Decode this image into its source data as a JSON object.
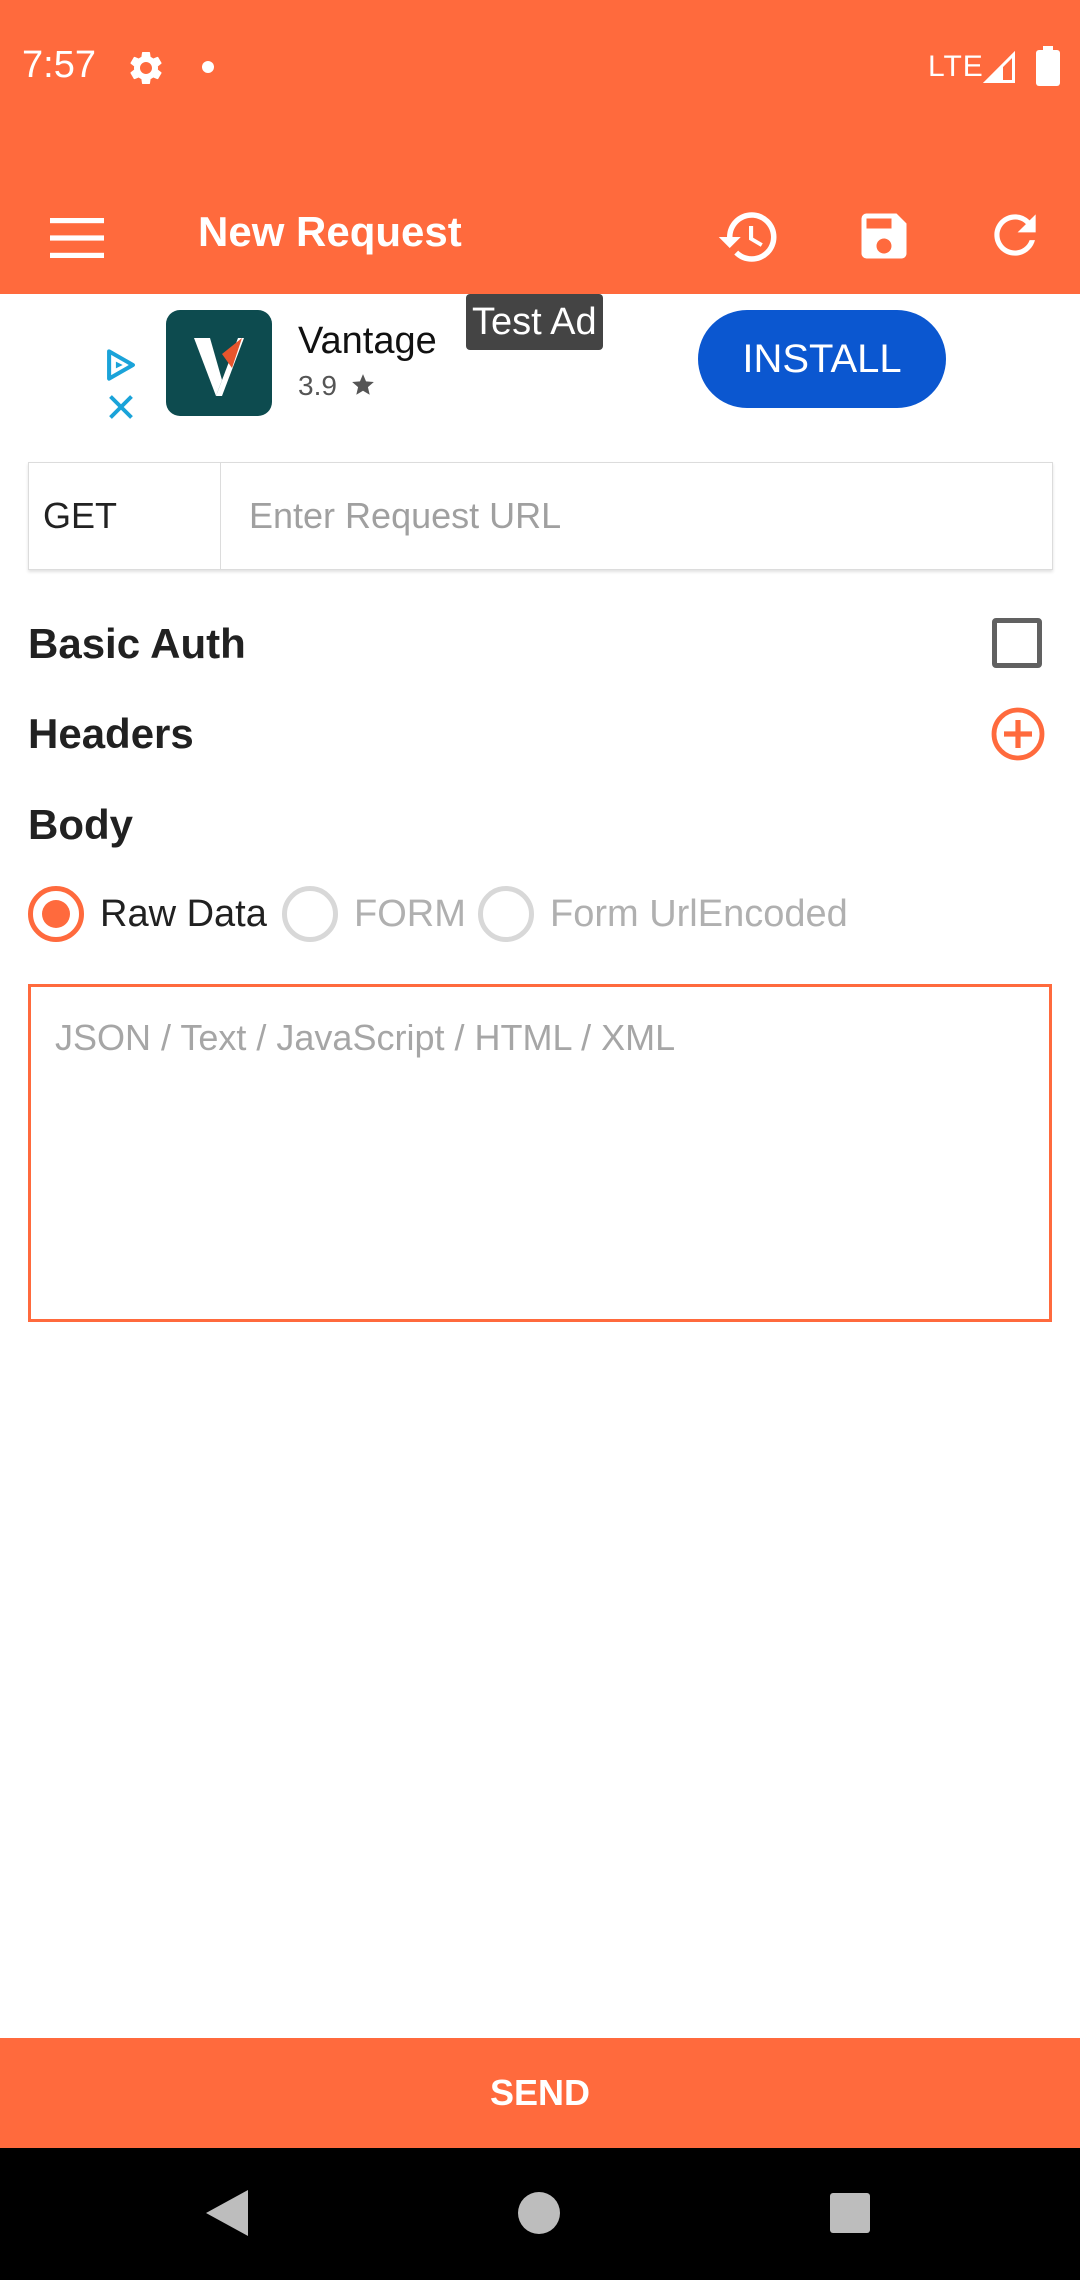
{
  "status_bar": {
    "time": "7:57",
    "network": "LTE",
    "icons": [
      "gear-icon",
      "notification-dot",
      "signal-icon",
      "battery-icon"
    ]
  },
  "app_bar": {
    "title": "New Request",
    "icons": [
      "menu-icon",
      "history-icon",
      "save-icon",
      "refresh-icon"
    ],
    "color": "#FF6A3D"
  },
  "ad": {
    "app_name": "Vantage",
    "rating": "3.9",
    "label": "Test Ad",
    "install_label": "INSTALL",
    "install_color": "#0B57D0"
  },
  "request": {
    "method": "GET",
    "url_placeholder": "Enter Request URL",
    "url_value": ""
  },
  "sections": {
    "basic_auth": "Basic Auth",
    "basic_auth_checked": false,
    "headers": "Headers",
    "body": "Body"
  },
  "body_types": [
    {
      "label": "Raw Data",
      "selected": true
    },
    {
      "label": "FORM",
      "selected": false
    },
    {
      "label": "Form UrlEncoded",
      "selected": false
    }
  ],
  "body_placeholder": "JSON / Text / JavaScript / HTML / XML",
  "send_label": "SEND"
}
